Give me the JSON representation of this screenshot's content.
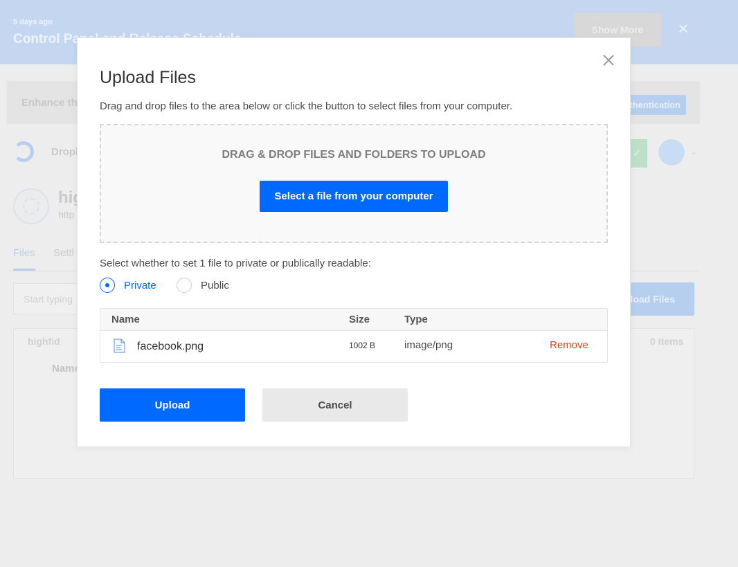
{
  "notice": {
    "meta": "5 days ago",
    "title": "Control Panel and Release Schedule",
    "show_more_label": "Show More",
    "close_icon": "close-icon"
  },
  "background": {
    "enhance_text": "Enhance th",
    "auth_button_label": "thentication",
    "nav_text": "Dropl",
    "green_button_icon": "check-icon",
    "space_name": "hig",
    "space_url": "http",
    "tabs": [
      {
        "label": "Files",
        "active": true
      },
      {
        "label": "Settl",
        "active": false
      }
    ],
    "filter_placeholder": "Start typing",
    "upload_button_label": "pload Files",
    "folder_crumb": "highfid",
    "item_count": "0 items",
    "name_column": "Name"
  },
  "modal": {
    "title": "Upload Files",
    "subtitle": "Drag and drop files to the area below or click the button to select files from your computer.",
    "dropzone_title": "DRAG & DROP FILES AND FOLDERS TO UPLOAD",
    "select_button_label": "Select a file from your computer",
    "privacy_prompt": "Select whether to set 1 file to private or publically readable:",
    "privacy_options": [
      {
        "label": "Private",
        "selected": true
      },
      {
        "label": "Public",
        "selected": false
      }
    ],
    "table": {
      "columns": [
        "Name",
        "Size",
        "Type"
      ],
      "rows": [
        {
          "name": "facebook.png",
          "size": "1002 B",
          "type": "image/png",
          "action": "Remove"
        }
      ]
    },
    "upload_label": "Upload",
    "cancel_label": "Cancel"
  },
  "colors": {
    "accent": "#0069ff",
    "danger": "#e0421c",
    "notice_bg": "#c5d7f0"
  }
}
